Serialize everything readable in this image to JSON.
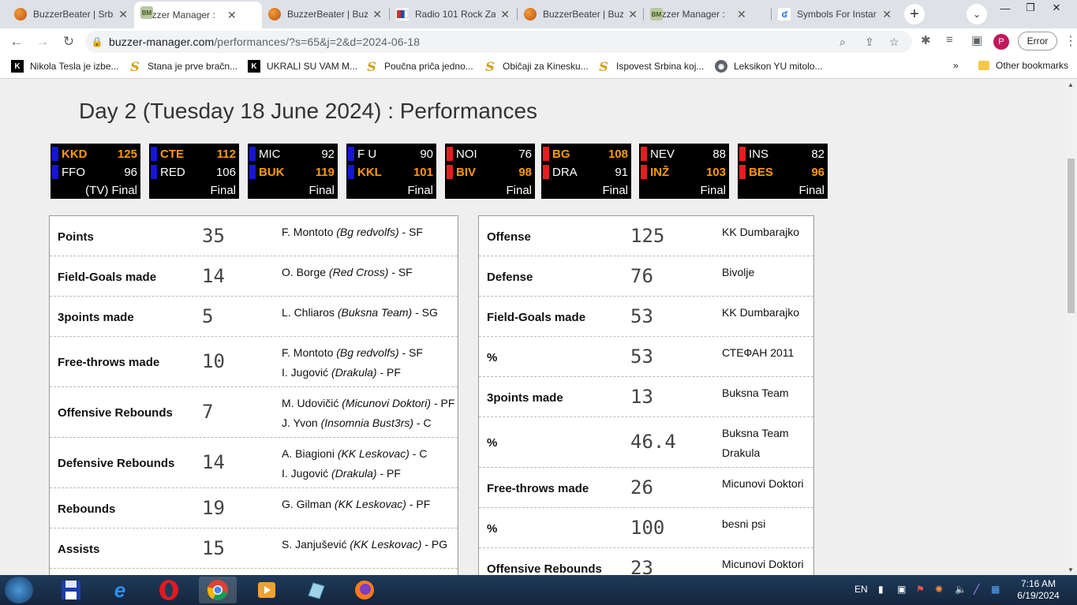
{
  "browser": {
    "tabs": [
      {
        "title": "BuzzerBeater | Srbi",
        "icon": "basketball-icon"
      },
      {
        "title": "Buzzer Manager :",
        "icon": "bm-icon",
        "active": true
      },
      {
        "title": "BuzzerBeater | Buz",
        "icon": "basketball-icon"
      },
      {
        "title": "Radio 101 Rock Za",
        "icon": "radio-icon"
      },
      {
        "title": "BuzzerBeater | Buz",
        "icon": "basketball-icon"
      },
      {
        "title": "Buzzer Manager :",
        "icon": "bm-icon"
      },
      {
        "title": "Symbols For Instar",
        "icon": "symbols-icon"
      }
    ],
    "url_host": "buzzer-manager.com",
    "url_path": "/performances/?s=65&j=2&d=2024-06-18",
    "profile_initial": "P",
    "error_label": "Error",
    "bookmarks": [
      {
        "label": "Nikola Tesla je izbe...",
        "icon": "k-icon"
      },
      {
        "label": "Stana je prve bračn...",
        "icon": "s-icon"
      },
      {
        "label": "UKRALI SU VAM M...",
        "icon": "k-icon"
      },
      {
        "label": "Poučna priča jedno...",
        "icon": "s-icon"
      },
      {
        "label": "Običaji za Kinesku...",
        "icon": "s-icon"
      },
      {
        "label": "Ispovest Srbina koj...",
        "icon": "s-icon"
      },
      {
        "label": "Leksikon YU mitolo...",
        "icon": "globe-icon"
      }
    ],
    "bookmarks_more": "»",
    "other_bookmarks": "Other bookmarks"
  },
  "page": {
    "title": "Day 2 (Tuesday 18 June 2024) : Performances",
    "games": [
      {
        "home": "KKD",
        "home_pts": "125",
        "home_win": true,
        "home_color": "#1515d6",
        "away": "FFO",
        "away_pts": "96",
        "away_win": false,
        "away_color": "#1515d6",
        "status": "(TV) Final"
      },
      {
        "home": "CTE",
        "home_pts": "112",
        "home_win": true,
        "home_color": "#1515d6",
        "away": "RED",
        "away_pts": "106",
        "away_win": false,
        "away_color": "#1515d6",
        "status": "Final"
      },
      {
        "home": "MIC",
        "home_pts": "92",
        "home_win": false,
        "home_color": "#1515d6",
        "away": "BUK",
        "away_pts": "119",
        "away_win": true,
        "away_color": "#1515d6",
        "status": "Final"
      },
      {
        "home": "F U",
        "home_pts": "90",
        "home_win": false,
        "home_color": "#1515d6",
        "away": "KKL",
        "away_pts": "101",
        "away_win": true,
        "away_color": "#1515d6",
        "status": "Final"
      },
      {
        "home": "NOI",
        "home_pts": "76",
        "home_win": false,
        "home_color": "#e02020",
        "away": "BIV",
        "away_pts": "98",
        "away_win": true,
        "away_color": "#e02020",
        "status": "Final"
      },
      {
        "home": "BG",
        "home_pts": "108",
        "home_win": true,
        "home_color": "#e02020",
        "away": "DRA",
        "away_pts": "91",
        "away_win": false,
        "away_color": "#e02020",
        "status": "Final"
      },
      {
        "home": "NEV",
        "home_pts": "88",
        "home_win": false,
        "home_color": "#e02020",
        "away": "INŽ",
        "away_pts": "103",
        "away_win": true,
        "away_color": "#e02020",
        "status": "Final"
      },
      {
        "home": "INS",
        "home_pts": "82",
        "home_win": false,
        "home_color": "#e02020",
        "away": "BES",
        "away_pts": "96",
        "away_win": true,
        "away_color": "#e02020",
        "status": "Final"
      }
    ],
    "player_stats": [
      {
        "label": "Points",
        "value": "35",
        "players": [
          {
            "name": "F. Montoto",
            "team": "(Bg redvolfs)",
            "pos": " - SF"
          }
        ]
      },
      {
        "label": "Field-Goals made",
        "value": "14",
        "players": [
          {
            "name": "O. Borge",
            "team": "(Red Cross)",
            "pos": " - SF"
          }
        ]
      },
      {
        "label": "3points made",
        "value": "5",
        "players": [
          {
            "name": "L. Chliaros",
            "team": "(Buksna Team)",
            "pos": " - SG"
          }
        ]
      },
      {
        "label": "Free-throws made",
        "value": "10",
        "players": [
          {
            "name": "F. Montoto",
            "team": "(Bg redvolfs)",
            "pos": " - SF"
          },
          {
            "name": "I. Jugović",
            "team": "(Drakula)",
            "pos": " - PF"
          }
        ]
      },
      {
        "label": "Offensive Rebounds",
        "value": "7",
        "players": [
          {
            "name": "M. Udovičić",
            "team": "(Micunovi Doktori)",
            "pos": " - PF"
          },
          {
            "name": "J. Yvon",
            "team": "(Insomnia Bust3rs)",
            "pos": " - C"
          }
        ]
      },
      {
        "label": "Defensive Rebounds",
        "value": "14",
        "players": [
          {
            "name": "A. Biagioni",
            "team": "(KK Leskovac)",
            "pos": " - C"
          },
          {
            "name": "I. Jugović",
            "team": "(Drakula)",
            "pos": " - PF"
          }
        ]
      },
      {
        "label": "Rebounds",
        "value": "19",
        "players": [
          {
            "name": "G. Gilman",
            "team": "(KK Leskovac)",
            "pos": " - PF"
          }
        ]
      },
      {
        "label": "Assists",
        "value": "15",
        "players": [
          {
            "name": "S. Janjušević",
            "team": "(KK Leskovac)",
            "pos": " - PG"
          }
        ]
      }
    ],
    "team_stats": [
      {
        "label": "Offense",
        "value": "125",
        "teams": [
          "KK Dumbarajko"
        ]
      },
      {
        "label": "Defense",
        "value": "76",
        "teams": [
          "Bivolje"
        ]
      },
      {
        "label": "Field-Goals made",
        "value": "53",
        "teams": [
          "KK Dumbarajko"
        ]
      },
      {
        "label": "%",
        "value": "53",
        "teams": [
          "СТЕФАН 2011"
        ]
      },
      {
        "label": "3points made",
        "value": "13",
        "teams": [
          "Buksna Team"
        ]
      },
      {
        "label": "%",
        "value": "46.4",
        "teams": [
          "Buksna Team",
          "Drakula"
        ]
      },
      {
        "label": "Free-throws made",
        "value": "26",
        "teams": [
          "Micunovi Doktori"
        ]
      },
      {
        "label": "%",
        "value": "100",
        "teams": [
          "besni psi"
        ]
      },
      {
        "label": "Offensive Rebounds",
        "value": "23",
        "teams": [
          "Micunovi Doktori"
        ]
      }
    ]
  },
  "taskbar": {
    "language": "EN",
    "time": "7:16 AM",
    "date": "6/19/2024"
  }
}
